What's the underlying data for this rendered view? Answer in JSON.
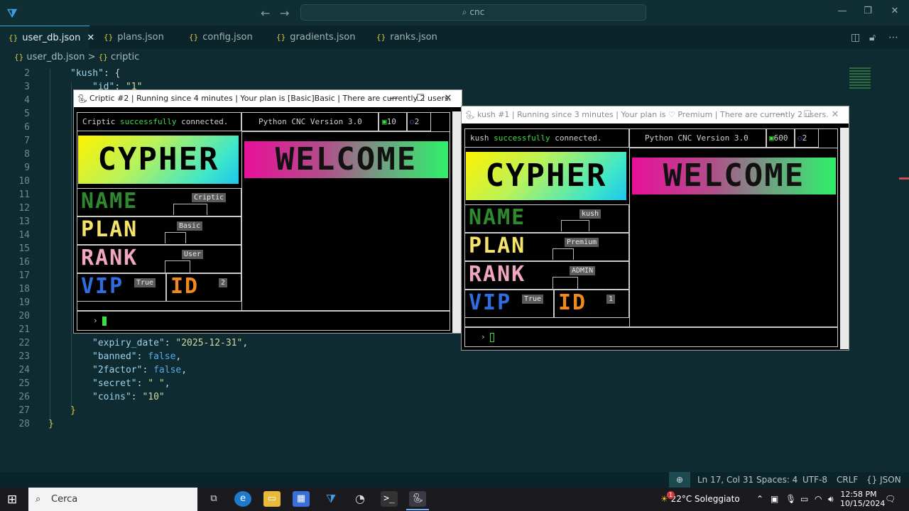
{
  "titlebar": {
    "search": "cnc"
  },
  "tabs": [
    {
      "label": "user_db.json",
      "icon": "{}"
    },
    {
      "label": "plans.json",
      "icon": "{}"
    },
    {
      "label": "config.json",
      "icon": "{}"
    },
    {
      "label": "gradients.json",
      "icon": "{}"
    },
    {
      "label": "ranks.json",
      "icon": "{}"
    }
  ],
  "breadcrumb": {
    "file": "user_db.json",
    "symbol": "criptic",
    "sep": ">",
    "icon": "{}"
  },
  "editor": {
    "line_numbers": [
      "2",
      "3",
      "4",
      "5",
      "6",
      "7",
      "8",
      "9",
      "10",
      "11",
      "12",
      "13",
      "14",
      "15",
      "16",
      "17",
      "18",
      "19",
      "20",
      "21",
      "22",
      "23",
      "24",
      "25",
      "26",
      "27",
      "28"
    ],
    "line2_key": "\"kush\"",
    "line2_rest": ": {",
    "line3_key": "\"id\"",
    "line3_val": "\"1\"",
    "line22_key": "\"expiry_date\"",
    "line22_val": "\"2025-12-31\"",
    "line23_key": "\"banned\"",
    "line23_val": "false",
    "line24_key": "\"2factor\"",
    "line24_val": "false",
    "line25_key": "\"secret\"",
    "line25_val": "\" \"",
    "line26_key": "\"coins\"",
    "line26_val": "\"10\"",
    "line27": "}",
    "line28": "}"
  },
  "window1": {
    "title": "Criptic #2 | Running since 4 minutes | Your plan is [Basic]Basic | There are currently 2 users.",
    "user": "Criptic",
    "connected_word": "successfully",
    "connected_tail": "connected.",
    "version": "Python CNC Version 3.0",
    "stat1": "10",
    "stat2": "2",
    "logo": "CYPHER",
    "welcome": "WELCOME",
    "name_label": "NAME",
    "name_val": "Criptic",
    "plan_label": "PLAN",
    "plan_val": "Basic",
    "rank_label": "RANK",
    "rank_val": "User",
    "vip_label": "VIP",
    "vip_val": "True",
    "id_label": "ID",
    "id_val": "2",
    "prompt": "›"
  },
  "window2": {
    "title": "kush #1 | Running since 3 minutes | Your plan is ♡ Premium | There are currently 2 users.",
    "user": "kush",
    "connected_word": "successfully",
    "connected_tail": "connected.",
    "version": "Python CNC Version 3.0",
    "stat1": "600",
    "stat2": "2",
    "logo": "CYPHER",
    "welcome": "WELCOME",
    "name_label": "NAME",
    "name_val": "kush",
    "plan_label": "PLAN",
    "plan_val": "Premium",
    "rank_label": "RANK",
    "rank_val": "ADMIN",
    "vip_label": "VIP",
    "vip_val": "True",
    "id_label": "ID",
    "id_val": "1",
    "prompt": "›"
  },
  "statusbar": {
    "pos": "Ln 17, Col 31",
    "spaces": "Spaces: 4",
    "enc": "UTF-8",
    "eol": "CRLF",
    "lang": "JSON",
    "lang_icon": "{}"
  },
  "taskbar": {
    "search": "Cerca",
    "weather": "22°C  Soleggiato",
    "time": "12:58 PM",
    "date": "10/15/2024",
    "badge": "1"
  },
  "colors": {
    "accent": "#3ba7d6",
    "bg": "#0d2b30",
    "green": "#3fdc3f"
  }
}
